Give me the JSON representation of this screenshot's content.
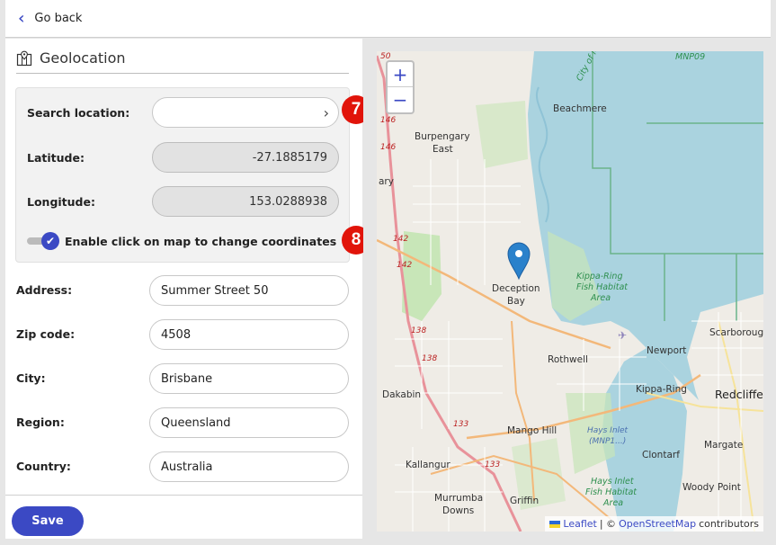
{
  "topbar": {
    "back_label": "Go back"
  },
  "section": {
    "title": "Geolocation"
  },
  "geo": {
    "search_label": "Search location:",
    "search_value": "",
    "latitude_label": "Latitude:",
    "latitude_value": "-27.1885179",
    "longitude_label": "Longitude:",
    "longitude_value": "153.0288938",
    "toggle_label": "Enable click on map to change coordinates",
    "toggle_on": true
  },
  "address": {
    "address_label": "Address:",
    "address_value": "Summer Street 50",
    "zip_label": "Zip code:",
    "zip_value": "4508",
    "city_label": "City:",
    "city_value": "Brisbane",
    "region_label": "Region:",
    "region_value": "Queensland",
    "country_label": "Country:",
    "country_value": "Australia"
  },
  "actions": {
    "save_label": "Save"
  },
  "badges": {
    "seven": "7",
    "eight": "8"
  },
  "map": {
    "zoom_in": "+",
    "zoom_out": "−",
    "attribution_leaflet": "Leaflet",
    "attribution_sep": "| ©",
    "attribution_osm": "OpenStreetMap",
    "attribution_tail": "contributors",
    "labels": {
      "beachmere": "Beachmere",
      "burpengary1": "Burpengary",
      "burpengary2": "East",
      "deception1": "Deception",
      "deception2": "Bay",
      "rothwell": "Rothwell",
      "newport": "Newport",
      "scarborough": "Scarboroug",
      "kippa": "Kippa-Ring",
      "redcliffe": "Redcliffe",
      "dakabin": "Dakabin",
      "mango": "Mango Hill",
      "kallangur": "Kallangur",
      "clontarf": "Clontarf",
      "margate": "Margate",
      "woody": "Woody Point",
      "murrumba1": "Murrumba",
      "murrumba2": "Downs",
      "griffin": "Griffin",
      "mnp": "MNP09",
      "kippa_fish1": "Kippa-Ring",
      "kippa_fish2": "Fish Habitat",
      "kippa_fish3": "Area",
      "hays1": "Hays Inlet",
      "hays2": "(MNP1...)",
      "hays_fish1": "Hays Inlet",
      "hays_fish2": "Fish Habitat",
      "hays_fish3": "Area",
      "city_moreton": "City of More",
      "r50": "50",
      "r146a": "146",
      "r146b": "146",
      "r142a": "142",
      "r142b": "142",
      "r138a": "138",
      "r138b": "138",
      "r133a": "133",
      "r133b": "133",
      "ary": "ary"
    },
    "colors": {
      "water": "#aad3df",
      "park": "#c8e6b8",
      "marker": "#2a81cb"
    }
  }
}
